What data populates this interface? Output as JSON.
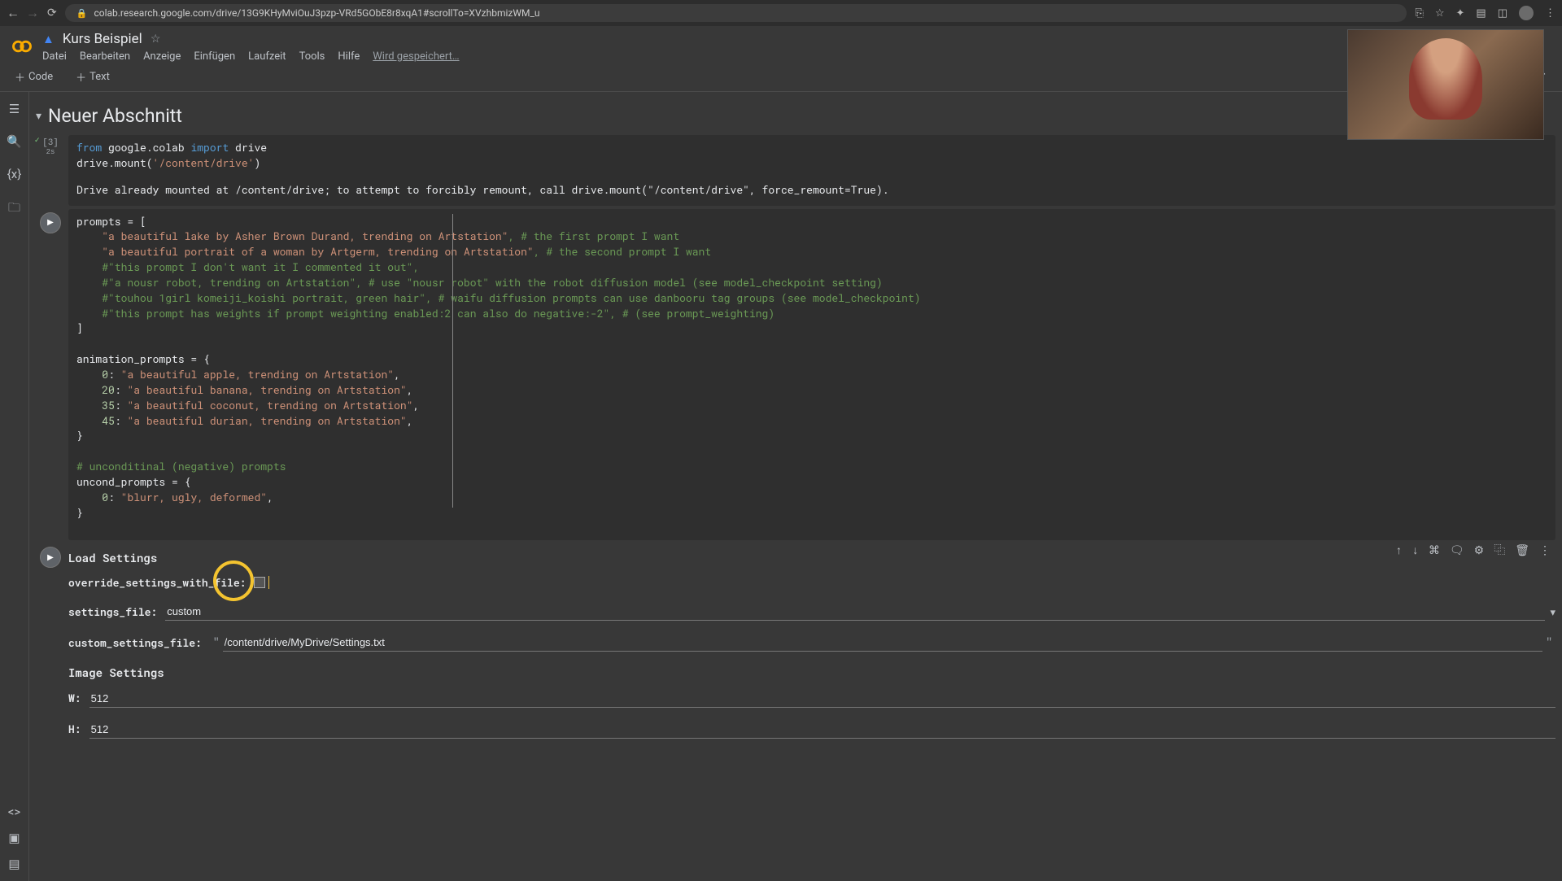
{
  "browser": {
    "url": "colab.research.google.com/drive/13G9KHyMviOuJ3pzp-VRd5GObE8r8xqA1#scrollTo=XVzhbmizWM_u"
  },
  "doc": {
    "title": "Kurs Beispiel",
    "menus": [
      "Datei",
      "Bearbeiten",
      "Anzeige",
      "Einfügen",
      "Laufzeit",
      "Tools",
      "Hilfe"
    ],
    "save_status": "Wird gespeichert…"
  },
  "toolbar": {
    "code": "Code",
    "text": "Text"
  },
  "section": {
    "title": "Neuer Abschnitt"
  },
  "cell1": {
    "exec_label": "[3]",
    "exec_time": "2s",
    "line1_from": "from",
    "line1_mod": " google.colab ",
    "line1_import": "import",
    "line1_name": " drive",
    "line2_a": "drive.mount(",
    "line2_str": "'/content/drive'",
    "line2_b": ")",
    "output": "Drive already mounted at /content/drive; to attempt to forcibly remount, call drive.mount(\"/content/drive\", force_remount=True)."
  },
  "cell2": {
    "l1": "prompts = [",
    "p1_str": "\"a beautiful lake by Asher Brown Durand, trending on Artstation\"",
    "p1_cmt": ", # the first prompt I want",
    "p2_str": "\"a beautiful portrait of a woman by Artgerm, trending on Artstation\"",
    "p2_cmt": ", # the second prompt I want",
    "p3_cmt": "#\"this prompt I don't want it I commented it out\",",
    "p4_cmt": "#\"a nousr robot, trending on Artstation\", # use \"nousr robot\" with the robot diffusion model (see model_checkpoint setting)",
    "p5_cmt": "#\"touhou 1girl komeiji_koishi portrait, green hair\", # waifu diffusion prompts can use danbooru tag groups (see model_checkpoint)",
    "p6_cmt": "#\"this prompt has weights if prompt weighting enabled:2 can also do negative:-2\", # (see prompt_weighting)",
    "close1": "]",
    "anim_head": "animation_prompts = {",
    "a0_k": "0",
    "a0_v": "\"a beautiful apple, trending on Artstation\"",
    "a1_k": "20",
    "a1_v": "\"a beautiful banana, trending on Artstation\"",
    "a2_k": "35",
    "a2_v": "\"a beautiful coconut, trending on Artstation\"",
    "a3_k": "45",
    "a3_v": "\"a beautiful durian, trending on Artstation\"",
    "close2": "}",
    "uncond_cmt": "# unconditinal (negative) prompts",
    "uncond_head": "uncond_prompts = {",
    "u0_k": "0",
    "u0_v": "\"blurr, ugly, deformed\"",
    "close3": "}"
  },
  "form": {
    "title1": "Load Settings",
    "f1_label": "override_settings_with_file:",
    "f2_label": "settings_file:",
    "f2_value": "custom",
    "f3_label": "custom_settings_file:",
    "f3_value": "/content/drive/MyDrive/Settings.txt",
    "title2": "Image Settings",
    "w_label": "W:",
    "w_value": "512",
    "h_label": "H:",
    "h_value": "512"
  }
}
